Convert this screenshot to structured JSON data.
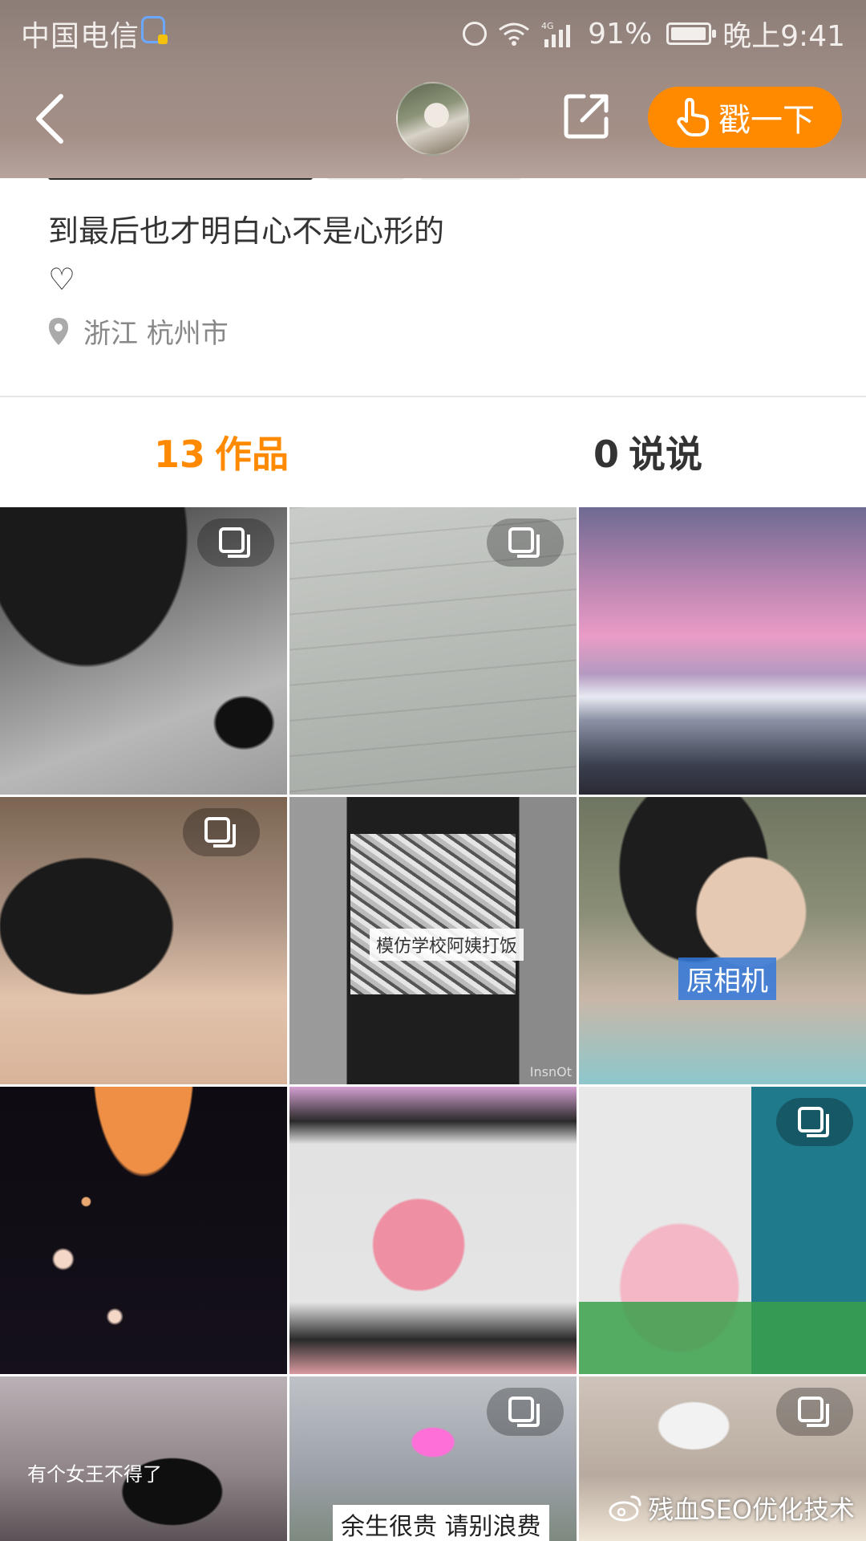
{
  "status_bar": {
    "carrier": "中国电信",
    "battery": "91%",
    "time": "晚上9:41",
    "network": "4G"
  },
  "nav": {
    "poke_label": "戳一下"
  },
  "profile": {
    "bio": "到最后也才明白心不是心形的\n♡",
    "location": "浙江 杭州市"
  },
  "tabs": [
    {
      "count": "13",
      "label": "作品"
    },
    {
      "count": "0",
      "label": "说说"
    }
  ],
  "grid": {
    "overlay_texts": {
      "original_camera": "原相机",
      "imitate_canteen": "模仿学校阿姨打饭",
      "queen_text": "有个女王不得了",
      "life_precious": "余生很贵 请别浪费",
      "insnot": "InsnOt"
    }
  },
  "watermark": "残血SEO优化技术",
  "colors": {
    "accent": "#ff8a00",
    "header_bg": "#9c8b84",
    "text_primary": "#333333",
    "text_secondary": "#888888"
  },
  "icons": [
    "back-icon",
    "share-icon",
    "hand-tap-icon",
    "location-pin-icon",
    "multi-image-icon",
    "alarm-icon",
    "wifi-icon",
    "signal-icon",
    "battery-icon",
    "weibo-icon"
  ]
}
